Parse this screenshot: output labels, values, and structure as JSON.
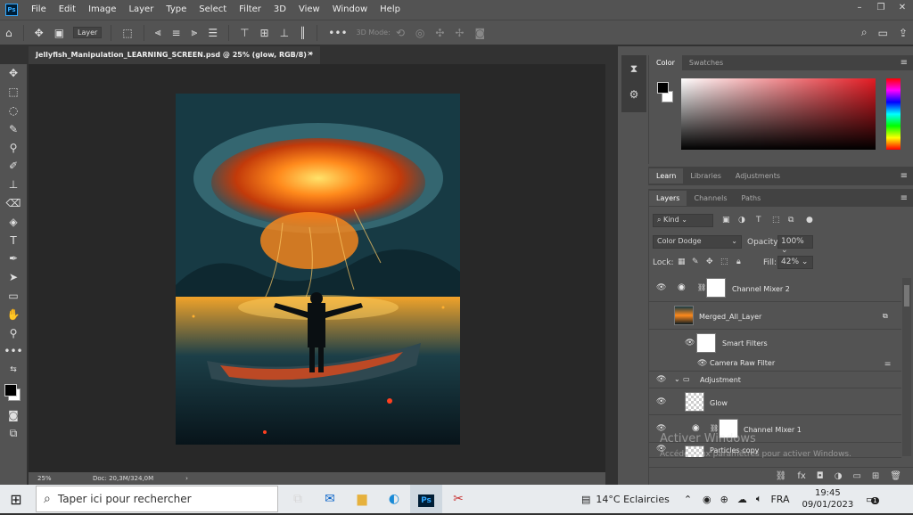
{
  "menu": [
    "File",
    "Edit",
    "Image",
    "Layer",
    "Type",
    "Select",
    "Filter",
    "3D",
    "View",
    "Window",
    "Help"
  ],
  "ps_logo": "Ps",
  "options": {
    "layer_select": "Layer",
    "threed_mode": "3D Mode:"
  },
  "document": {
    "tab_title": "Jellyfish_Manipulation_LEARNING_SCREEN.psd @ 25% (glow, RGB/8) *",
    "zoom": "25%",
    "doc_size": "Doc: 20,3M/324,0M"
  },
  "color_panel": {
    "tabs": [
      "Color",
      "Swatches"
    ]
  },
  "learn_panel": {
    "tabs": [
      "Learn",
      "Libraries",
      "Adjustments"
    ]
  },
  "layers_panel": {
    "tabs": [
      "Layers",
      "Channels",
      "Paths"
    ],
    "kind_label": "Kind",
    "blend_mode": "Color Dodge",
    "opacity_label": "Opacity:",
    "opacity": "100%",
    "lock_label": "Lock:",
    "fill_label": "Fill:",
    "fill": "42%",
    "layers": [
      "Channel Mixer 2",
      "Merged_All_Layer",
      "Smart Filters",
      "Camera Raw Filter",
      "Adjustment",
      "Glow",
      "Channel Mixer 1",
      "Particles copy"
    ]
  },
  "watermark": {
    "line1": "Activer Windows",
    "line2": "Accédez aux paramètres pour activer Windows."
  },
  "taskbar": {
    "search_placeholder": "Taper ici pour rechercher",
    "weather": "14°C  Eclaircies",
    "lang": "FRA",
    "time": "19:45",
    "date": "09/01/2023",
    "notif": "1"
  }
}
